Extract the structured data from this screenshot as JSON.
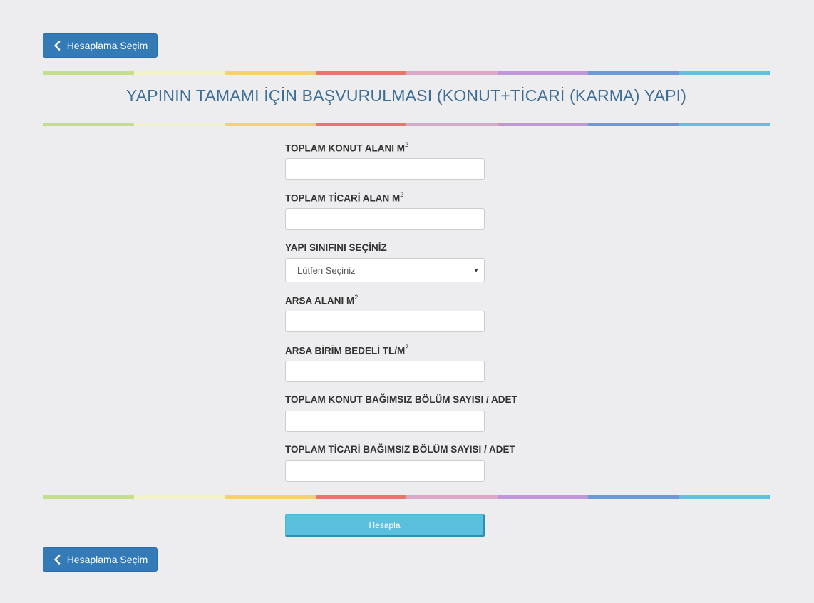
{
  "nav": {
    "back_label": "Hesaplama Seçim"
  },
  "page": {
    "title": "YAPININ TAMAMI İÇİN BAŞVURULMASI (KONUT+TİCARİ (KARMA) YAPI)"
  },
  "rainbow_colors": [
    "#c5de8a",
    "#f1f4c6",
    "#fbcd78",
    "#e8766f",
    "#dca6c4",
    "#bf95dc",
    "#6b9ad8",
    "#64bde4"
  ],
  "form": {
    "konut_alani": {
      "label": "TOPLAM KONUT ALANI M",
      "sup": "2",
      "value": ""
    },
    "ticari_alan": {
      "label": "TOPLAM TİCARİ ALAN M",
      "sup": "2",
      "value": ""
    },
    "yapi_sinifi": {
      "label": "YAPI SINIFINI SEÇİNİZ",
      "selected": "Lütfen Seçiniz"
    },
    "arsa_alani": {
      "label": "ARSA ALANI M",
      "sup": "2",
      "value": ""
    },
    "arsa_birim_bedeli": {
      "label": "ARSA BİRİM BEDELİ TL/M",
      "sup": "2",
      "value": ""
    },
    "konut_bolum_sayisi": {
      "label": "TOPLAM KONUT BAĞIMSIZ BÖLÜM SAYISI / ADET",
      "value": ""
    },
    "ticari_bolum_sayisi": {
      "label": "TOPLAM TİCARİ BAĞIMSIZ BÖLÜM SAYISI / ADET",
      "value": ""
    },
    "submit_label": "Hesapla"
  },
  "colors": {
    "primary": "#337ab7",
    "info": "#5bc0de",
    "title": "#3d6e96",
    "background": "#ededef"
  }
}
